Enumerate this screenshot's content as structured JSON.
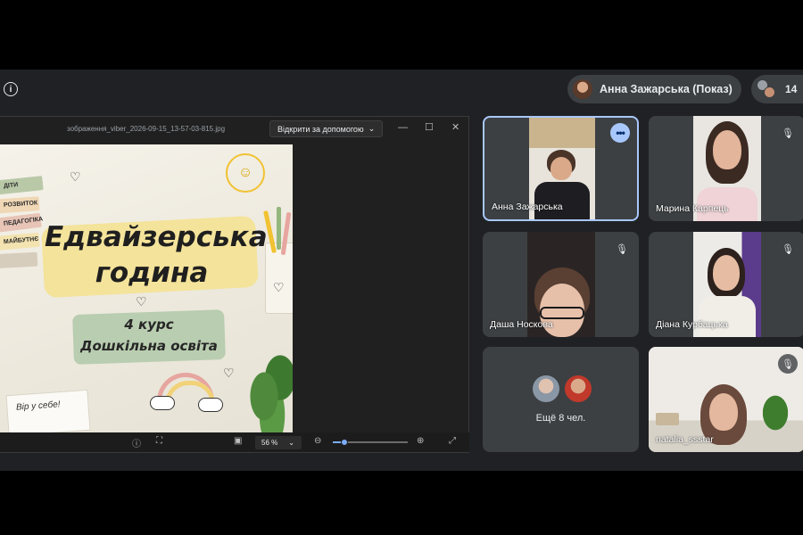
{
  "topbar": {
    "presenter_label": "Анна Зажарська (Показ)",
    "participant_count": "14"
  },
  "viewer": {
    "file_name": "зображення_viber_2026-09-15_13-57-03-815.jpg",
    "open_with_label": "Відкрити за допомогою",
    "zoom_label": "56 %",
    "zoom_fraction": 0.15
  },
  "poster": {
    "title_line1": "Едвайзерська",
    "title_line2": "година",
    "course_line1": "4 курс",
    "course_line2": "Дошкільна освіта",
    "books": [
      "ДІТИ",
      "РОЗВИТОК",
      "ПЕДАГОГІКА",
      "МАЙБУТНЄ"
    ],
    "note": "Вір у себе!"
  },
  "participants": [
    {
      "name": "Анна Зажарська",
      "speaking": true,
      "muted": false
    },
    {
      "name": "Марина Карпець",
      "muted": true
    },
    {
      "name": "Даша Носкова",
      "muted": true
    },
    {
      "name": "Діана Курбацька",
      "muted": true
    },
    {
      "name": "natalia_ssstar",
      "muted": true
    }
  ],
  "more_tile": {
    "label": "Ещё 8 чел."
  },
  "colors": {
    "active_border": "#a8c7fa",
    "tile_bg": "#3c4043",
    "stage_bg": "#202124"
  }
}
